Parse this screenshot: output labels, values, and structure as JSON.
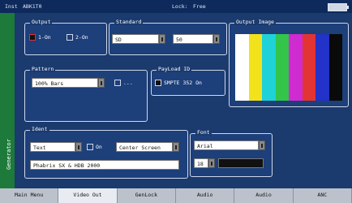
{
  "status": {
    "left_a": "Inst",
    "left_b": "ABK1T0",
    "lock_label": "Lock:",
    "lock_value": "Free"
  },
  "sidebar": {
    "label": "Generator"
  },
  "output": {
    "title": "Output",
    "opt1": "1-On",
    "opt2": "2-On"
  },
  "standard": {
    "title": "Standard",
    "value1": "SD",
    "value2": "50"
  },
  "output_image": {
    "title": "Output Image",
    "colors": [
      "#ffffff",
      "#f2e21c",
      "#1fd2d8",
      "#33c44a",
      "#d02ad1",
      "#e23434",
      "#2332c8",
      "#0a0a0a"
    ]
  },
  "pattern": {
    "title": "Pattern",
    "value": "100% Bars",
    "check_label": "..."
  },
  "payload": {
    "title": "PayLoad ID",
    "check_label": "SMPTE 352 On"
  },
  "ident": {
    "title": "Ident",
    "type_value": "Text",
    "on_label": "On",
    "position_value": "Center Screen",
    "text_value": "Phabrix SX & HDB 2000"
  },
  "font": {
    "title": "Font",
    "family": "Arial",
    "size": "18"
  },
  "tabs": [
    "Main Menu",
    "Video Out",
    "GenLock",
    "Audio",
    "Audio",
    "ANC"
  ],
  "active_tab": 1
}
